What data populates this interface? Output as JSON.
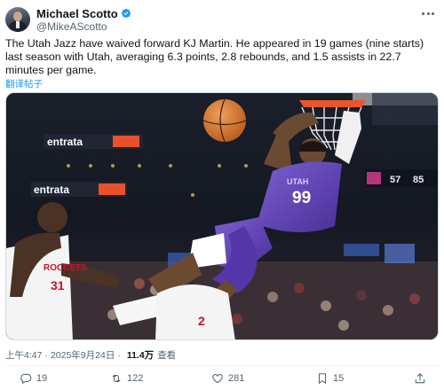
{
  "author": {
    "display_name": "Michael Scotto",
    "handle": "@MikeAScotto",
    "verified": true
  },
  "tweet": {
    "text": "The Utah Jazz have waived forward KJ Martin. He appeared in 19 games (nine starts) last season with Utah, averaging 6.3 points, 2.8 rebounds, and 1.5 assists in 22.7 minutes per game.",
    "translate_label": "翻译帖子"
  },
  "media": {
    "banner_text_upper": "entrata",
    "banner_text_lower": "entrata",
    "jersey_team": "UTAH",
    "jersey_number": "99",
    "opponent_team": "ROCKETS",
    "opponent_number": "31",
    "opponent_number_2": "2",
    "scoreboard_left": "57",
    "scoreboard_right": "85"
  },
  "meta": {
    "time": "上午4:47",
    "date": "2025年9月24日",
    "views_count": "11.4万",
    "views_label": "查看"
  },
  "actions": {
    "reply_count": "19",
    "retweet_count": "122",
    "like_count": "281",
    "bookmark_count": "15"
  },
  "colors": {
    "accent": "#1d9bf0",
    "secondary_text": "#536471",
    "jazz_purple": "#5b3fb0"
  }
}
